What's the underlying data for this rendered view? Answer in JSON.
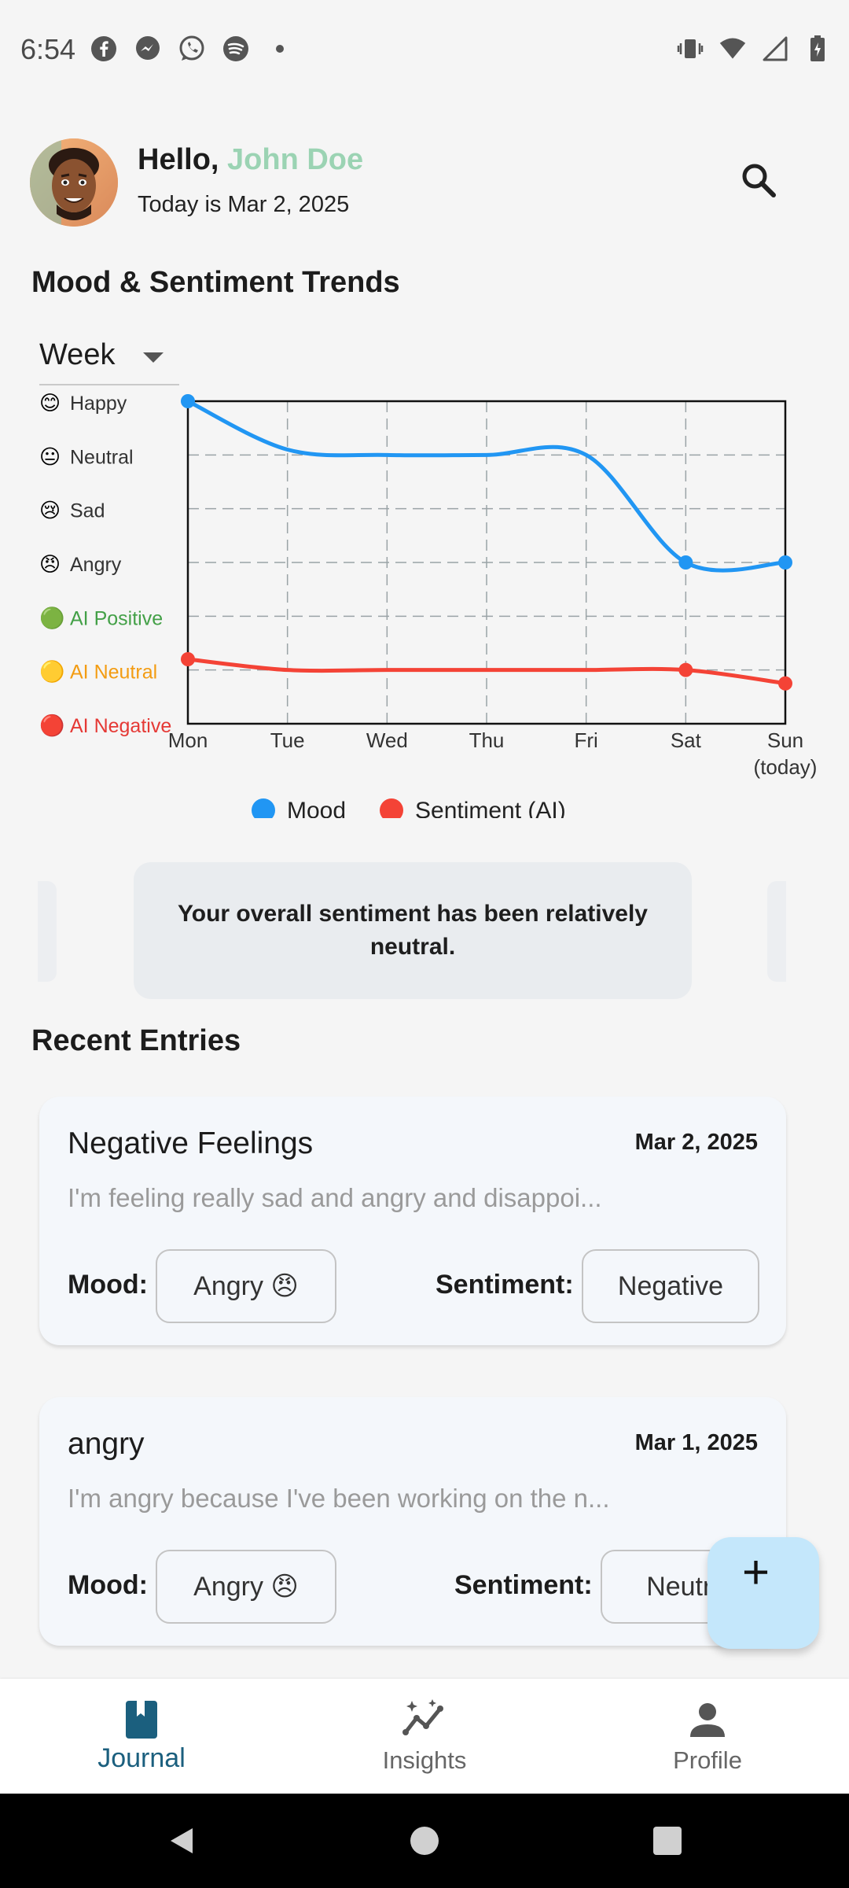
{
  "status_bar": {
    "time": "6:54",
    "left_icons": [
      "facebook-icon",
      "messenger-icon",
      "whatsapp-icon",
      "spotify-icon",
      "dot-icon"
    ],
    "right_icons": [
      "vibrate-icon",
      "wifi-icon",
      "signal-icon",
      "battery-icon"
    ]
  },
  "header": {
    "greeting_prefix": "Hello, ",
    "user_name": "John Doe",
    "date_text": "Today is Mar 2, 2025",
    "search_icon": "search-icon",
    "name_color": "#9bd3b3"
  },
  "trends": {
    "title": "Mood & Sentiment Trends",
    "period": "Week"
  },
  "chart_data": {
    "type": "line",
    "categories": [
      "Mon",
      "Tue",
      "Wed",
      "Thu",
      "Fri",
      "Sat",
      "Sun\n(today)"
    ],
    "category_labels": [
      [
        "Mon"
      ],
      [
        "Tue"
      ],
      [
        "Wed"
      ],
      [
        "Thu"
      ],
      [
        "Fri"
      ],
      [
        "Sat"
      ],
      [
        "Sun",
        "(today)"
      ]
    ],
    "y_levels": [
      {
        "emoji": "😊",
        "label": "Happy",
        "color": "#333333"
      },
      {
        "emoji": "😐",
        "label": "Neutral",
        "color": "#333333"
      },
      {
        "emoji": "😢",
        "label": "Sad",
        "color": "#333333"
      },
      {
        "emoji": "😠",
        "label": "Angry",
        "color": "#333333"
      },
      {
        "emoji": "🟢",
        "label": "AI Positive",
        "color": "#43a047"
      },
      {
        "emoji": "🟡",
        "label": "AI Neutral",
        "color": "#f39c12"
      },
      {
        "emoji": "🔴",
        "label": "AI Negative",
        "color": "#e53935"
      }
    ],
    "series": [
      {
        "name": "Mood",
        "color": "#2196f3",
        "values": [
          6,
          5.1,
          5,
          5,
          5,
          3,
          3
        ],
        "marked_points": [
          0,
          5,
          6
        ]
      },
      {
        "name": "Sentiment (AI)",
        "color": "#f44336",
        "values": [
          1.2,
          1,
          1,
          1,
          1,
          1,
          0.75
        ],
        "marked_points": [
          0,
          5,
          6
        ]
      }
    ],
    "ylim": [
      0,
      6
    ],
    "grid": true,
    "legend_position": "bottom-center"
  },
  "insight": {
    "text": "Your overall sentiment has been relatively neutral."
  },
  "recent": {
    "title": "Recent Entries",
    "mood_label": "Mood:",
    "sentiment_label": "Sentiment:",
    "entries": [
      {
        "title": "Negative Feelings",
        "date": "Mar 2, 2025",
        "preview": "I'm feeling really sad and angry and disappoi...",
        "mood": "Angry 😠",
        "sentiment": "Negative"
      },
      {
        "title": "angry",
        "date": "Mar 1, 2025",
        "preview": "I'm angry because I've been working on the n...",
        "mood": "Angry 😠",
        "sentiment": "Neutral"
      }
    ]
  },
  "fab": {
    "icon": "plus-icon",
    "label": "+"
  },
  "bottom_nav": {
    "items": [
      {
        "label": "Journal",
        "icon": "journal-icon",
        "active": true
      },
      {
        "label": "Insights",
        "icon": "insights-icon",
        "active": false
      },
      {
        "label": "Profile",
        "icon": "profile-icon",
        "active": false
      }
    ],
    "active_color": "#1b5f7e"
  },
  "system_nav": [
    "back-icon",
    "home-icon",
    "recents-icon"
  ]
}
